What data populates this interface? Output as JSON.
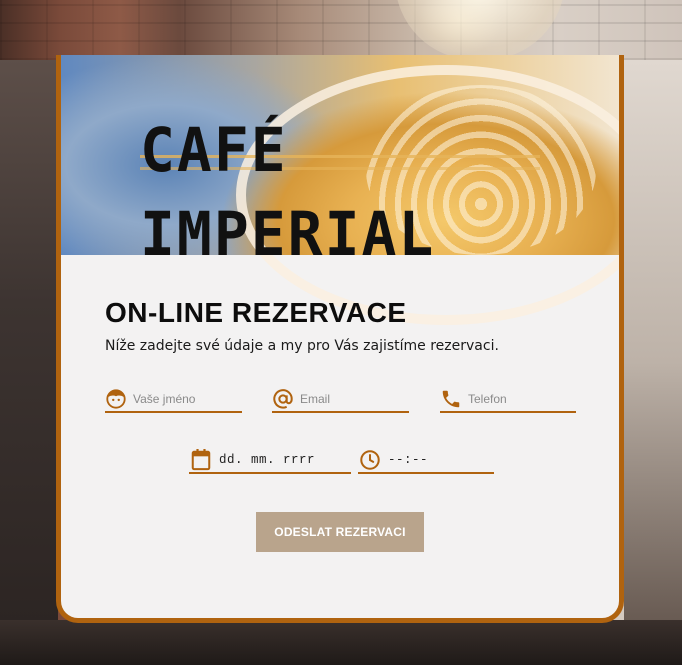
{
  "brand": {
    "name": "CAFÉ IMPERIAL"
  },
  "form": {
    "title": "ON-LINE REZERVACE",
    "subtitle": "Níže zadejte své údaje a my pro Vás zajistíme rezervaci.",
    "name_placeholder": "Vaše jméno",
    "email_placeholder": "Email",
    "phone_placeholder": "Telefon",
    "date_placeholder": "dd. mm. rrrr",
    "time_placeholder": "--:--",
    "submit_label": "ODESLAT REZERVACI"
  },
  "icons": {
    "name": "person-face-icon",
    "email": "at-sign-icon",
    "phone": "phone-icon",
    "date": "calendar-icon",
    "time": "clock-icon"
  },
  "colors": {
    "accent": "#b0630f",
    "button": "#b9a48c",
    "card_bg": "#f3f2f2"
  }
}
